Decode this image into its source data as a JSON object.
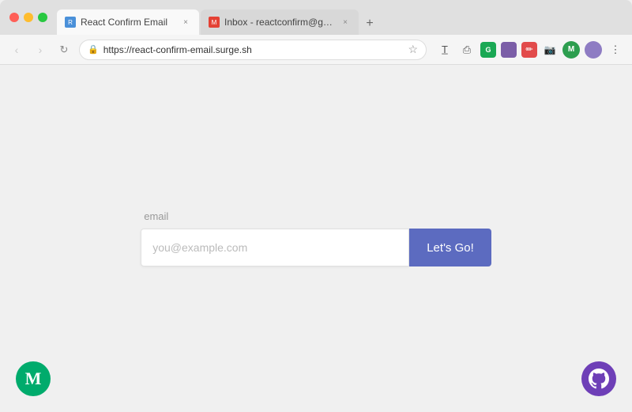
{
  "browser": {
    "tabs": [
      {
        "id": "tab-1",
        "title": "React Confirm Email",
        "active": true,
        "favicon_label": "R"
      },
      {
        "id": "tab-2",
        "title": "Inbox - reactconfirm@gmail.co",
        "active": false,
        "favicon_label": "M"
      }
    ],
    "tab_new_label": "+",
    "nav": {
      "back_label": "‹",
      "forward_label": "›",
      "refresh_label": "↻"
    },
    "url": "https://react-confirm-email.surge.sh",
    "lock_icon": "🔒",
    "bookmark_icon": "☆"
  },
  "page": {
    "email_label": "email",
    "email_placeholder": "you@example.com",
    "email_value": "",
    "submit_label": "Let's Go!",
    "medium_logo": "M",
    "github_logo": "🐙"
  },
  "toolbar": {
    "icons": [
      "T",
      "⚙",
      "□",
      "✏",
      "📷",
      "●",
      "●",
      "⋮"
    ]
  }
}
